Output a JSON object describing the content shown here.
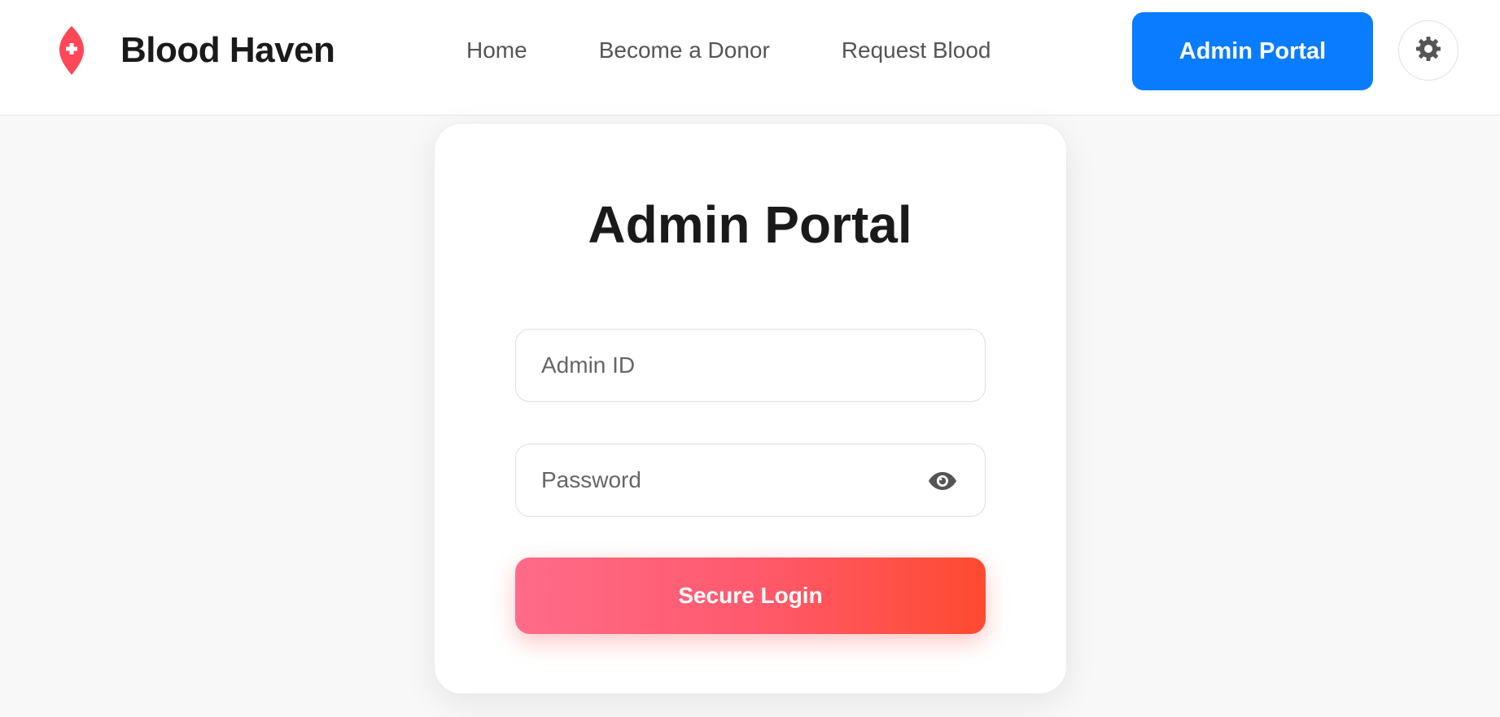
{
  "brand": {
    "name": "Blood Haven",
    "logo_icon": "blood-drop-plus-icon",
    "logo_color": "#ff4757"
  },
  "nav": {
    "links": [
      "Home",
      "Become a Donor",
      "Request Blood"
    ]
  },
  "header_actions": {
    "admin_button": "Admin Portal",
    "admin_button_color": "#0a7cff",
    "theme_toggle_icon": "gear-icon"
  },
  "login_card": {
    "title": "Admin Portal",
    "admin_id_placeholder": "Admin ID",
    "password_placeholder": "Password",
    "password_toggle_icon": "eye-icon",
    "submit_label": "Secure Login",
    "submit_gradient": [
      "#ff6b88",
      "#ff4a30"
    ]
  }
}
